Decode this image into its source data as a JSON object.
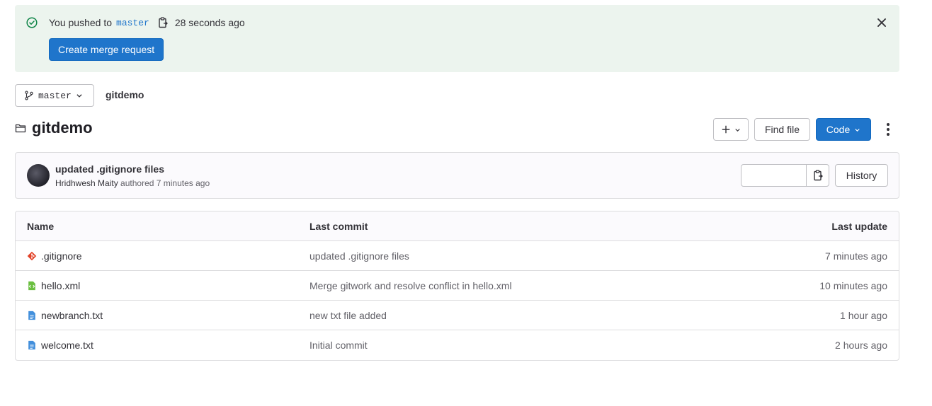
{
  "alert": {
    "text_prefix": "You pushed to",
    "branch": "master",
    "time": "28 seconds ago",
    "button_label": "Create merge request"
  },
  "branch_selector": {
    "value": "master"
  },
  "breadcrumb": {
    "repo": "gitdemo"
  },
  "repo": {
    "title": "gitdemo"
  },
  "actions": {
    "find_file": "Find file",
    "code": "Code"
  },
  "last_commit": {
    "title": "updated .gitignore files",
    "author": "Hridhwesh Maity",
    "meta": "authored 7 minutes ago",
    "history_label": "History"
  },
  "table": {
    "headers": {
      "name": "Name",
      "last_commit": "Last commit",
      "last_update": "Last update"
    },
    "rows": [
      {
        "name": ".gitignore",
        "commit": "updated .gitignore files",
        "updated": "7 minutes ago",
        "icon": "git-icon"
      },
      {
        "name": "hello.xml",
        "commit": "Merge gitwork and resolve conflict in hello.xml",
        "updated": "10 minutes ago",
        "icon": "xml-file-icon"
      },
      {
        "name": "newbranch.txt",
        "commit": "new txt file added",
        "updated": "1 hour ago",
        "icon": "text-file-icon"
      },
      {
        "name": "welcome.txt",
        "commit": "Initial commit",
        "updated": "2 hours ago",
        "icon": "text-file-icon"
      }
    ]
  },
  "colors": {
    "accent": "#1f75cb",
    "alert_bg": "#ecf4ee",
    "success": "#108548"
  }
}
